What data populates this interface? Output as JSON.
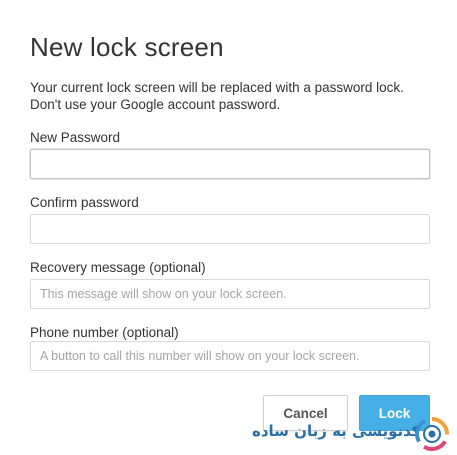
{
  "dialog": {
    "title": "New lock screen",
    "description_line1": "Your current lock screen will be replaced with a password lock.",
    "description_line2": "Don't use your Google account password."
  },
  "fields": {
    "new_password": {
      "label": "New Password",
      "value": "",
      "placeholder": ""
    },
    "confirm_password": {
      "label": "Confirm password",
      "value": "",
      "placeholder": ""
    },
    "recovery_message": {
      "label": "Recovery message (optional)",
      "value": "",
      "placeholder": "This message will show on your lock screen."
    },
    "phone_number": {
      "label": "Phone number (optional)",
      "value": "",
      "placeholder": "A button to call this number will show on your lock screen."
    }
  },
  "buttons": {
    "cancel_label": "Cancel",
    "lock_label": "Lock"
  },
  "watermark": {
    "text": "کدنویسی به زبان ساده",
    "logo_icon": "site-logo-icon"
  },
  "colors": {
    "primary_button": "#46b0e6",
    "text": "#333333",
    "watermark_text": "#2a6fa8"
  }
}
